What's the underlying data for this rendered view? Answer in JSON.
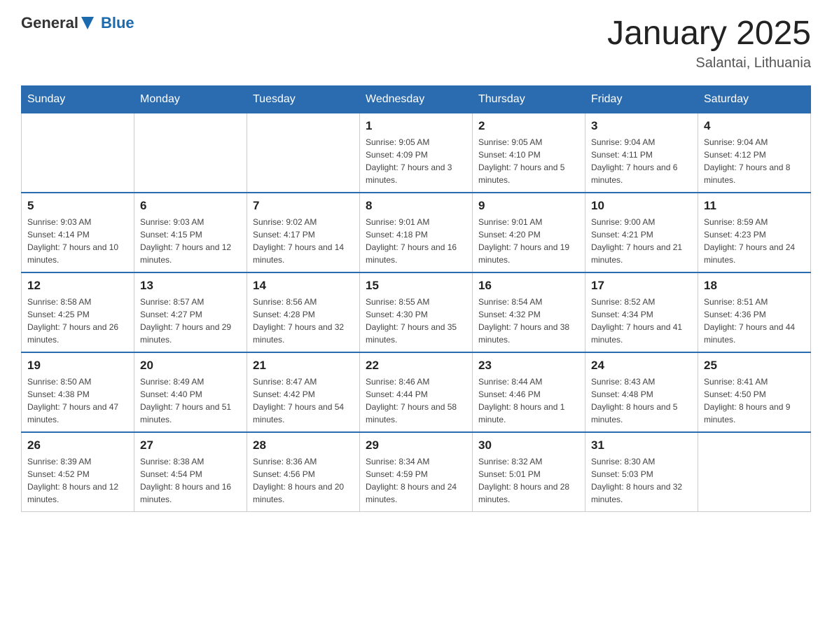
{
  "header": {
    "logo": {
      "text_general": "General",
      "text_blue": "Blue",
      "tagline": "GeneralBlue"
    },
    "title": "January 2025",
    "subtitle": "Salantai, Lithuania"
  },
  "days_of_week": [
    "Sunday",
    "Monday",
    "Tuesday",
    "Wednesday",
    "Thursday",
    "Friday",
    "Saturday"
  ],
  "weeks": [
    [
      {
        "day": "",
        "sunrise": "",
        "sunset": "",
        "daylight": ""
      },
      {
        "day": "",
        "sunrise": "",
        "sunset": "",
        "daylight": ""
      },
      {
        "day": "",
        "sunrise": "",
        "sunset": "",
        "daylight": ""
      },
      {
        "day": "1",
        "sunrise": "Sunrise: 9:05 AM",
        "sunset": "Sunset: 4:09 PM",
        "daylight": "Daylight: 7 hours and 3 minutes."
      },
      {
        "day": "2",
        "sunrise": "Sunrise: 9:05 AM",
        "sunset": "Sunset: 4:10 PM",
        "daylight": "Daylight: 7 hours and 5 minutes."
      },
      {
        "day": "3",
        "sunrise": "Sunrise: 9:04 AM",
        "sunset": "Sunset: 4:11 PM",
        "daylight": "Daylight: 7 hours and 6 minutes."
      },
      {
        "day": "4",
        "sunrise": "Sunrise: 9:04 AM",
        "sunset": "Sunset: 4:12 PM",
        "daylight": "Daylight: 7 hours and 8 minutes."
      }
    ],
    [
      {
        "day": "5",
        "sunrise": "Sunrise: 9:03 AM",
        "sunset": "Sunset: 4:14 PM",
        "daylight": "Daylight: 7 hours and 10 minutes."
      },
      {
        "day": "6",
        "sunrise": "Sunrise: 9:03 AM",
        "sunset": "Sunset: 4:15 PM",
        "daylight": "Daylight: 7 hours and 12 minutes."
      },
      {
        "day": "7",
        "sunrise": "Sunrise: 9:02 AM",
        "sunset": "Sunset: 4:17 PM",
        "daylight": "Daylight: 7 hours and 14 minutes."
      },
      {
        "day": "8",
        "sunrise": "Sunrise: 9:01 AM",
        "sunset": "Sunset: 4:18 PM",
        "daylight": "Daylight: 7 hours and 16 minutes."
      },
      {
        "day": "9",
        "sunrise": "Sunrise: 9:01 AM",
        "sunset": "Sunset: 4:20 PM",
        "daylight": "Daylight: 7 hours and 19 minutes."
      },
      {
        "day": "10",
        "sunrise": "Sunrise: 9:00 AM",
        "sunset": "Sunset: 4:21 PM",
        "daylight": "Daylight: 7 hours and 21 minutes."
      },
      {
        "day": "11",
        "sunrise": "Sunrise: 8:59 AM",
        "sunset": "Sunset: 4:23 PM",
        "daylight": "Daylight: 7 hours and 24 minutes."
      }
    ],
    [
      {
        "day": "12",
        "sunrise": "Sunrise: 8:58 AM",
        "sunset": "Sunset: 4:25 PM",
        "daylight": "Daylight: 7 hours and 26 minutes."
      },
      {
        "day": "13",
        "sunrise": "Sunrise: 8:57 AM",
        "sunset": "Sunset: 4:27 PM",
        "daylight": "Daylight: 7 hours and 29 minutes."
      },
      {
        "day": "14",
        "sunrise": "Sunrise: 8:56 AM",
        "sunset": "Sunset: 4:28 PM",
        "daylight": "Daylight: 7 hours and 32 minutes."
      },
      {
        "day": "15",
        "sunrise": "Sunrise: 8:55 AM",
        "sunset": "Sunset: 4:30 PM",
        "daylight": "Daylight: 7 hours and 35 minutes."
      },
      {
        "day": "16",
        "sunrise": "Sunrise: 8:54 AM",
        "sunset": "Sunset: 4:32 PM",
        "daylight": "Daylight: 7 hours and 38 minutes."
      },
      {
        "day": "17",
        "sunrise": "Sunrise: 8:52 AM",
        "sunset": "Sunset: 4:34 PM",
        "daylight": "Daylight: 7 hours and 41 minutes."
      },
      {
        "day": "18",
        "sunrise": "Sunrise: 8:51 AM",
        "sunset": "Sunset: 4:36 PM",
        "daylight": "Daylight: 7 hours and 44 minutes."
      }
    ],
    [
      {
        "day": "19",
        "sunrise": "Sunrise: 8:50 AM",
        "sunset": "Sunset: 4:38 PM",
        "daylight": "Daylight: 7 hours and 47 minutes."
      },
      {
        "day": "20",
        "sunrise": "Sunrise: 8:49 AM",
        "sunset": "Sunset: 4:40 PM",
        "daylight": "Daylight: 7 hours and 51 minutes."
      },
      {
        "day": "21",
        "sunrise": "Sunrise: 8:47 AM",
        "sunset": "Sunset: 4:42 PM",
        "daylight": "Daylight: 7 hours and 54 minutes."
      },
      {
        "day": "22",
        "sunrise": "Sunrise: 8:46 AM",
        "sunset": "Sunset: 4:44 PM",
        "daylight": "Daylight: 7 hours and 58 minutes."
      },
      {
        "day": "23",
        "sunrise": "Sunrise: 8:44 AM",
        "sunset": "Sunset: 4:46 PM",
        "daylight": "Daylight: 8 hours and 1 minute."
      },
      {
        "day": "24",
        "sunrise": "Sunrise: 8:43 AM",
        "sunset": "Sunset: 4:48 PM",
        "daylight": "Daylight: 8 hours and 5 minutes."
      },
      {
        "day": "25",
        "sunrise": "Sunrise: 8:41 AM",
        "sunset": "Sunset: 4:50 PM",
        "daylight": "Daylight: 8 hours and 9 minutes."
      }
    ],
    [
      {
        "day": "26",
        "sunrise": "Sunrise: 8:39 AM",
        "sunset": "Sunset: 4:52 PM",
        "daylight": "Daylight: 8 hours and 12 minutes."
      },
      {
        "day": "27",
        "sunrise": "Sunrise: 8:38 AM",
        "sunset": "Sunset: 4:54 PM",
        "daylight": "Daylight: 8 hours and 16 minutes."
      },
      {
        "day": "28",
        "sunrise": "Sunrise: 8:36 AM",
        "sunset": "Sunset: 4:56 PM",
        "daylight": "Daylight: 8 hours and 20 minutes."
      },
      {
        "day": "29",
        "sunrise": "Sunrise: 8:34 AM",
        "sunset": "Sunset: 4:59 PM",
        "daylight": "Daylight: 8 hours and 24 minutes."
      },
      {
        "day": "30",
        "sunrise": "Sunrise: 8:32 AM",
        "sunset": "Sunset: 5:01 PM",
        "daylight": "Daylight: 8 hours and 28 minutes."
      },
      {
        "day": "31",
        "sunrise": "Sunrise: 8:30 AM",
        "sunset": "Sunset: 5:03 PM",
        "daylight": "Daylight: 8 hours and 32 minutes."
      },
      {
        "day": "",
        "sunrise": "",
        "sunset": "",
        "daylight": ""
      }
    ]
  ]
}
